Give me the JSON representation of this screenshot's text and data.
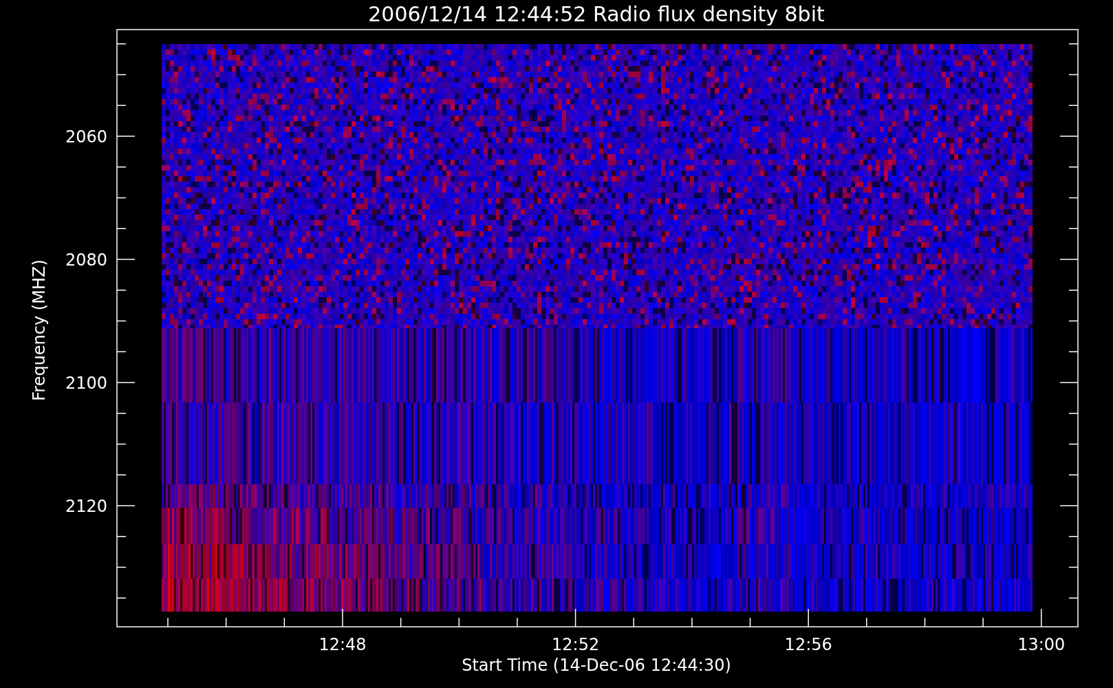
{
  "title": "2006/12/14 12:44:52 Radio flux density 8bit",
  "y_axis": {
    "label": "Frequency (MHZ)",
    "ticks": [
      "2060",
      "2080",
      "2100",
      "2120"
    ]
  },
  "x_axis": {
    "label": "Start Time (14-Dec-06 12:44:30)",
    "ticks": [
      "12:48",
      "12:52",
      "12:56",
      "13:00"
    ]
  }
}
